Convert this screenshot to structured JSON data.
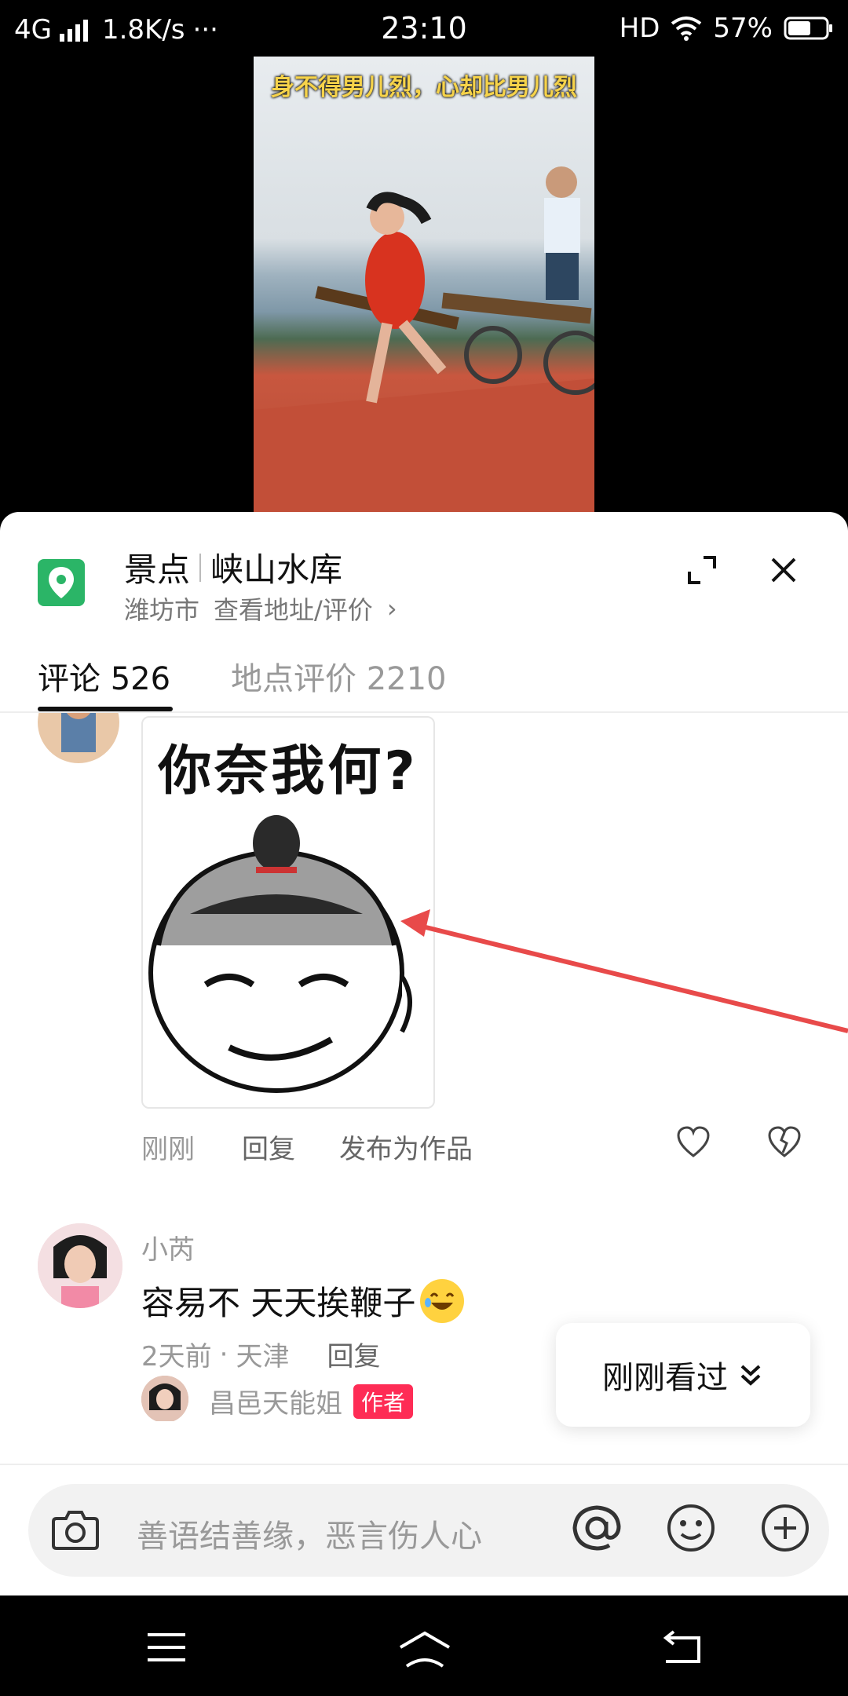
{
  "status_bar": {
    "network": "4G",
    "speed": "1.8K/s",
    "more": "···",
    "time": "23:10",
    "hd": "HD",
    "battery": "57%"
  },
  "video": {
    "caption": "身不得男儿烈，心却比男儿烈"
  },
  "poi": {
    "category": "景点",
    "name": "峡山水库",
    "city": "潍坊市",
    "view_label": "查看地址/评价",
    "chevron": "›"
  },
  "tabs": [
    {
      "label": "评论 526"
    },
    {
      "label": "地点评价 2210"
    }
  ],
  "comment1": {
    "meme_text": "你奈我何?",
    "time": "刚刚",
    "reply": "回复",
    "publish": "发布为作品"
  },
  "comment2": {
    "user": "小芮",
    "text": "容易不 天天挨鞭子",
    "time": "2天前",
    "dot": "·",
    "location": "天津",
    "reply": "回复"
  },
  "subreply": {
    "user": "昌邑天能姐",
    "badge": "作者"
  },
  "recent_button": {
    "label": "刚刚看过"
  },
  "input": {
    "placeholder": "善语结善缘，恶言伤人心"
  },
  "colors": {
    "accent": "#fe2c55",
    "poi_green": "#2bb567",
    "arrow_red": "#e84a4a"
  }
}
